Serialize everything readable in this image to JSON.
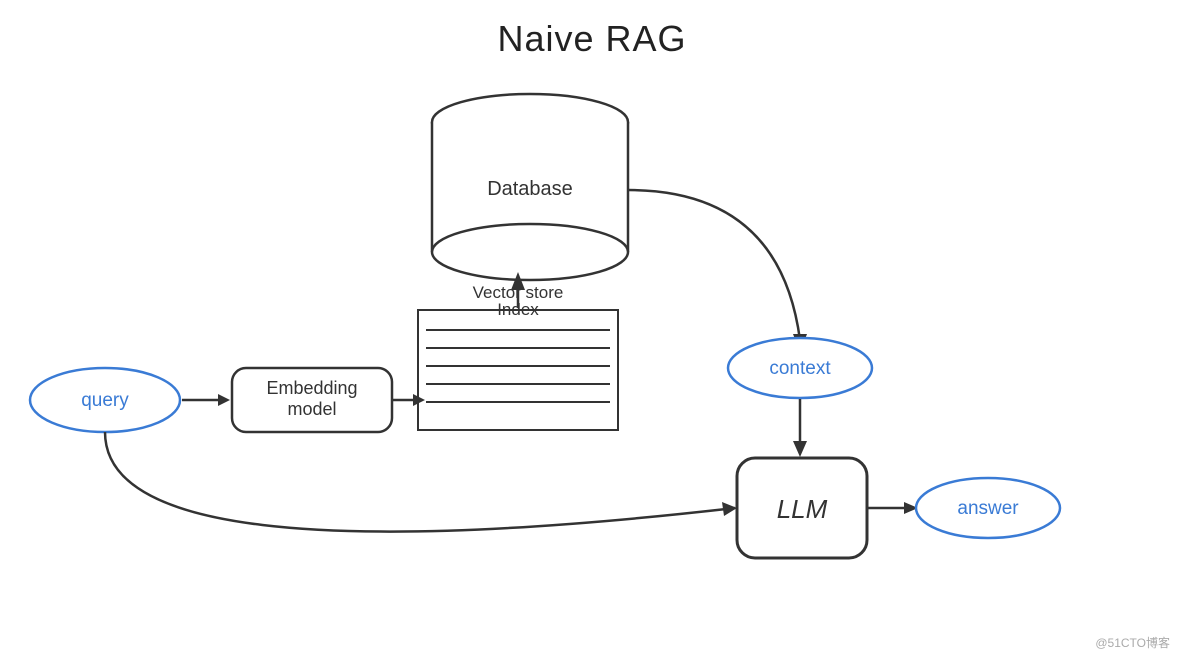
{
  "title": "Naive RAG",
  "nodes": {
    "query": {
      "label": "query"
    },
    "embedding_model": {
      "label": "Embedding\nmodel"
    },
    "database": {
      "label": "Database"
    },
    "vector_store": {
      "label": "Vector store\nIndex"
    },
    "context": {
      "label": "context"
    },
    "llm": {
      "label": "LLM"
    },
    "answer": {
      "label": "answer"
    }
  },
  "watermark": "@51CTO博客"
}
